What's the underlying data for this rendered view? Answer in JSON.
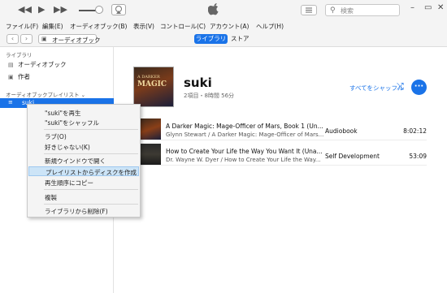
{
  "search": {
    "placeholder": "検索"
  },
  "menubar": [
    "ファイル(F)",
    "編集(E)",
    "オーディオブック(B)",
    "表示(V)",
    "コントロール(C)",
    "アカウント(A)",
    "ヘルプ(H)"
  ],
  "nav": {
    "media_label": "オーディオブック",
    "tab_library": "ライブラリ",
    "tab_store": "ストア"
  },
  "sidebar": {
    "library_heading": "ライブラリ",
    "library_items": [
      "オーディオブック",
      "作者"
    ],
    "playlist_heading": "オーディオブックプレイリスト",
    "selected_playlist": "suki"
  },
  "playlist": {
    "title": "suki",
    "meta": "2項目・8時間 56分",
    "shuffle_label": "すべてをシャッフル",
    "art_line1": "A DARKER",
    "art_line2": "MAGIC",
    "tracks": [
      {
        "title": "A Darker Magic: Mage-Officer of Mars, Book 1 (Un...",
        "subtitle": "Glynn Stewart / A Darker Magic: Mage-Officer of Mars...",
        "genre": "Audiobook",
        "duration": "8:02:12"
      },
      {
        "title": "How to Create Your Life the Way You Want It (Una...",
        "subtitle": "Dr. Wayne W. Dyer / How to Create Your Life the Way...",
        "genre": "Self Development",
        "duration": "53:09"
      }
    ]
  },
  "context_menu": {
    "items": [
      "\"suki\"を再生",
      "\"suki\"をシャッフル",
      "ラブ(O)",
      "好きじゃない(K)",
      "新規ウインドウで開く",
      "プレイリストからディスクを作成",
      "再生順序にコピー",
      "複製",
      "ライブラリから削除(F)"
    ],
    "highlighted_index": 5
  },
  "colors": {
    "accent": "#1a73e8",
    "highlight": "#cce4f7"
  }
}
